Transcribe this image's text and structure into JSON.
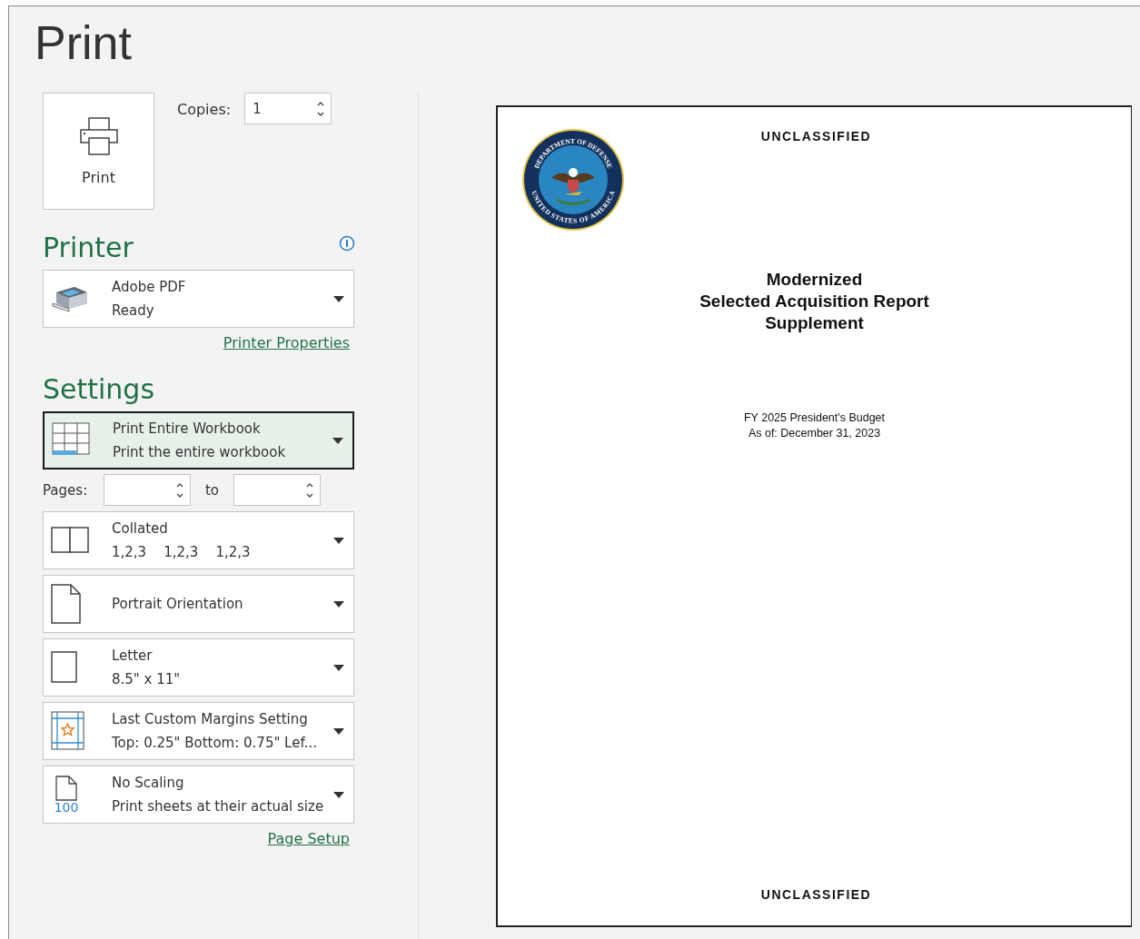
{
  "title": "Print",
  "print_button": {
    "label": "Print"
  },
  "copies": {
    "label": "Copies:",
    "value": "1"
  },
  "printer": {
    "heading": "Printer",
    "name": "Adobe PDF",
    "status": "Ready",
    "properties_link": "Printer Properties"
  },
  "settings": {
    "heading": "Settings",
    "items": [
      {
        "kind": "scope",
        "line1": "Print Entire Workbook",
        "line2": "Print the entire workbook",
        "selected": true
      },
      {
        "kind": "pages",
        "label": "Pages:",
        "to": "to"
      },
      {
        "kind": "collation",
        "line1": "Collated",
        "line2": "1,2,3    1,2,3    1,2,3",
        "selected": false
      },
      {
        "kind": "orientation",
        "line1": "Portrait Orientation",
        "selected": false
      },
      {
        "kind": "paper_size",
        "line1": "Letter",
        "line2": "8.5\" x 11\"",
        "selected": false
      },
      {
        "kind": "margins",
        "line1": "Last Custom Margins Setting",
        "line2": "Top: 0.25\" Bottom: 0.75\" Lef...",
        "selected": false
      },
      {
        "kind": "scaling",
        "icon_text": "100",
        "line1": "No Scaling",
        "line2": "Print sheets at their actual size",
        "selected": false
      }
    ],
    "page_setup_link": "Page Setup"
  },
  "preview": {
    "header": "UNCLASSIFIED",
    "seal": {
      "top_text": "DEPARTMENT OF DEFENSE",
      "bottom_text": "UNITED STATES OF AMERICA"
    },
    "title_lines": [
      "Modernized",
      "Selected Acquisition Report",
      "Supplement"
    ],
    "subtitle_lines": [
      "FY 2025 President's Budget",
      "As of: December 31, 2023"
    ],
    "footer": "UNCLASSIFIED"
  }
}
